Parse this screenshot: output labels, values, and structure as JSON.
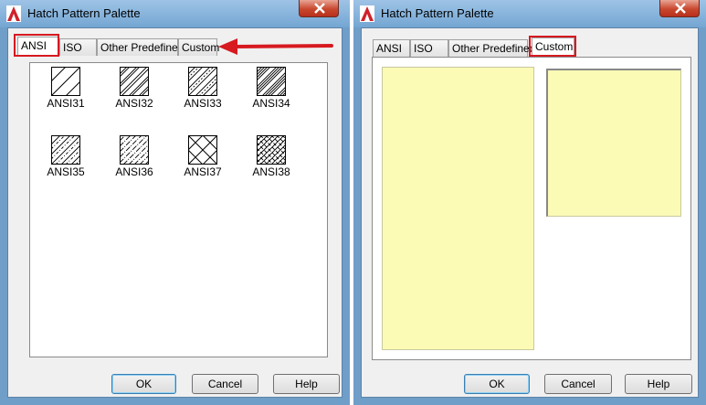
{
  "left_dialog": {
    "title": "Hatch Pattern Palette",
    "tabs": [
      {
        "label": "ANSI",
        "active": true
      },
      {
        "label": "ISO"
      },
      {
        "label": "Other Predefined"
      },
      {
        "label": "Custom"
      }
    ],
    "patterns": [
      {
        "label": "ANSI31",
        "icon": "hatch-ansi31-icon"
      },
      {
        "label": "ANSI32",
        "icon": "hatch-ansi32-icon"
      },
      {
        "label": "ANSI33",
        "icon": "hatch-ansi33-icon"
      },
      {
        "label": "ANSI34",
        "icon": "hatch-ansi34-icon"
      },
      {
        "label": "ANSI35",
        "icon": "hatch-ansi35-icon"
      },
      {
        "label": "ANSI36",
        "icon": "hatch-ansi36-icon"
      },
      {
        "label": "ANSI37",
        "icon": "hatch-ansi37-icon"
      },
      {
        "label": "ANSI38",
        "icon": "hatch-ansi38-icon"
      }
    ],
    "buttons": {
      "ok": "OK",
      "cancel": "Cancel",
      "help": "Help"
    }
  },
  "right_dialog": {
    "title": "Hatch Pattern Palette",
    "tabs": [
      {
        "label": "ANSI"
      },
      {
        "label": "ISO"
      },
      {
        "label": "Other Predefined"
      },
      {
        "label": "Custom",
        "active": true
      }
    ],
    "buttons": {
      "ok": "OK",
      "cancel": "Cancel",
      "help": "Help"
    }
  },
  "annotations": {
    "highlight_color": "#d71920",
    "arrow_color": "#d71920"
  },
  "colors": {
    "titlebar": "#74a6d3",
    "preview_fill": "#fbfbb6",
    "close_button": "#c8472e"
  }
}
